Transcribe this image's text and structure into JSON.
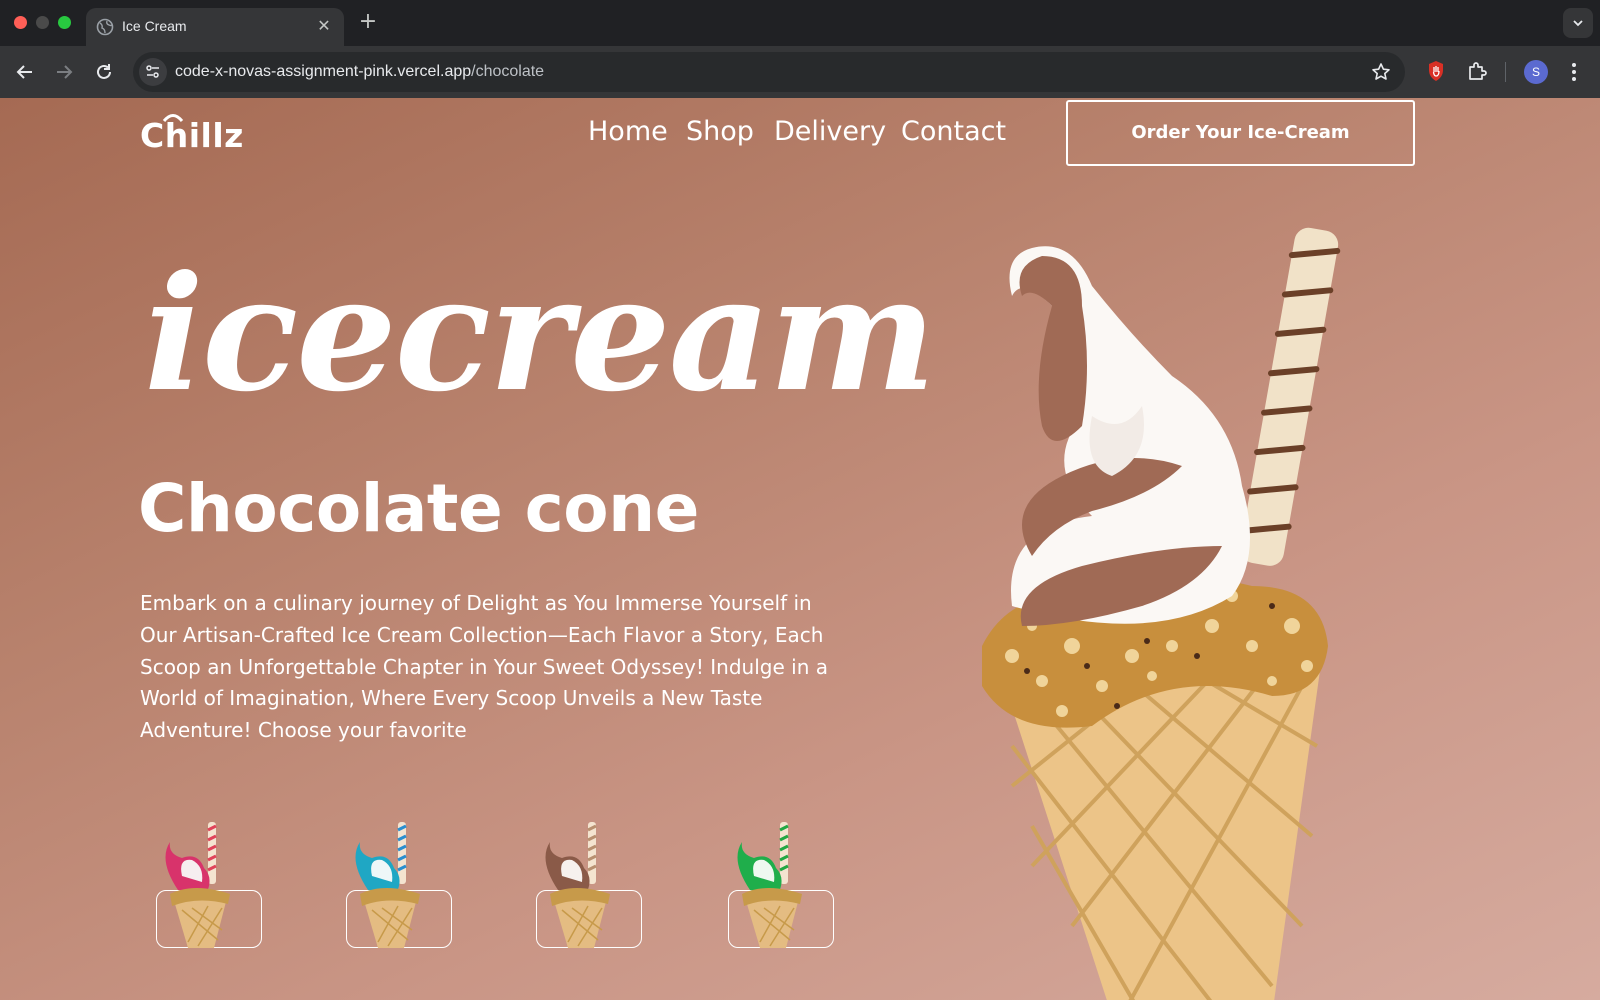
{
  "browser": {
    "tab_title": "Ice Cream",
    "tab_close": "✕",
    "new_tab": "+",
    "url_host": "code-x-novas-assignment-pink.vercel.app",
    "url_path": "/chocolate",
    "profile_initial": "S"
  },
  "site": {
    "logo": "Chillz",
    "nav": [
      {
        "label": "Home"
      },
      {
        "label": "Shop"
      },
      {
        "label": "Delivery"
      },
      {
        "label": "Contact"
      }
    ],
    "order_button": "Order Your Ice-Cream"
  },
  "hero": {
    "script_title": "icecream",
    "flavor_title": "Chocolate cone",
    "description": "Embark on a culinary journey of Delight as You Immerse Yourself in Our Artisan-Crafted Ice Cream Collection—Each Flavor a Story, Each Scoop an Unforgettable Chapter in Your Sweet Odyssey! Indulge in a World of Imagination, Where Every Scoop Unveils a New Taste Adventure! Choose your favorite"
  },
  "flavors": [
    {
      "icon": "strawberry-cone-icon",
      "color": "#d8336b",
      "stripe": "#e0445a"
    },
    {
      "icon": "blueberry-cone-icon",
      "color": "#1fa7c4",
      "stripe": "#2a8fd0"
    },
    {
      "icon": "chocolate-cone-icon",
      "color": "#8a5a48",
      "stripe": "#b89070"
    },
    {
      "icon": "mint-cone-icon",
      "color": "#1fae4b",
      "stripe": "#22a844"
    }
  ],
  "colors": {
    "page_gradient_start": "#a56a53",
    "page_gradient_end": "#d6ab9f",
    "text": "#ffffff",
    "chrome_bg": "#202124"
  }
}
